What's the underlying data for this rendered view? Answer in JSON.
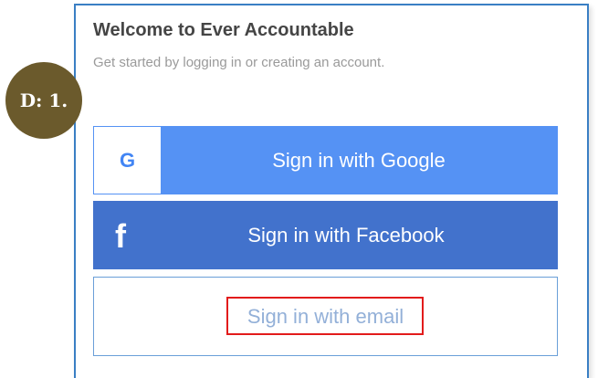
{
  "header": {
    "title": "Welcome to Ever Accountable",
    "subtitle": "Get started by logging in or creating an account."
  },
  "badge": {
    "label": "D: 1."
  },
  "buttons": {
    "google": {
      "label": "Sign in with Google",
      "icon": "google-g-icon",
      "icon_text": "G",
      "color": "#5592f4"
    },
    "facebook": {
      "label": "Sign in with Facebook",
      "icon": "facebook-f-icon",
      "icon_text": "f",
      "color": "#4272cc"
    },
    "email": {
      "label": "Sign in with email"
    }
  },
  "colors": {
    "card_border": "#3a7fc4",
    "highlight": "#e21b1b",
    "badge_bg": "#6b5a2c"
  }
}
